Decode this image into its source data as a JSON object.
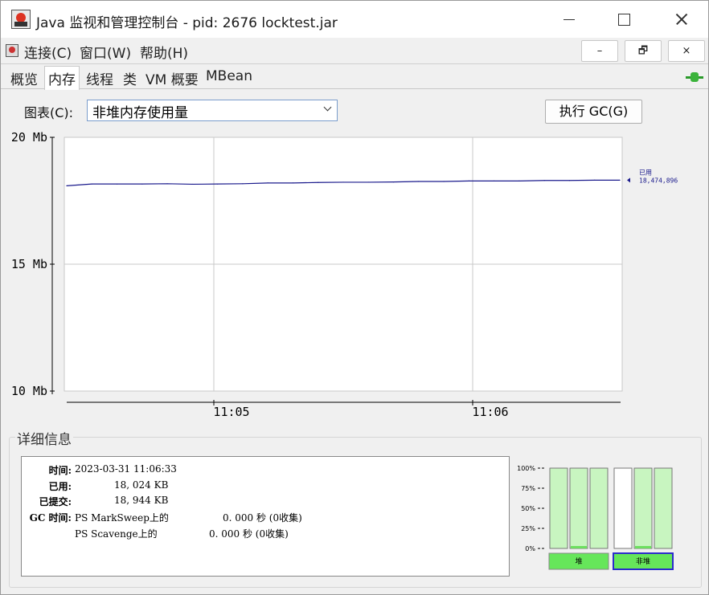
{
  "window": {
    "title": "Java 监视和管理控制台 - pid: 2676 locktest.jar"
  },
  "menu": {
    "items": [
      "连接(C)",
      "窗口(W)",
      "帮助(H)"
    ],
    "mdi_buttons": [
      "–",
      "🗗",
      "×"
    ]
  },
  "tabs": [
    {
      "label": "概览",
      "active": false
    },
    {
      "label": "内存",
      "active": true
    },
    {
      "label": "线程",
      "active": false
    },
    {
      "label": "类",
      "active": false
    },
    {
      "label": "VM 概要",
      "active": false
    },
    {
      "label": "MBean",
      "active": false
    }
  ],
  "chart_selector": {
    "label": "图表(C):",
    "value": "非堆内存使用量"
  },
  "gc_button": {
    "label": "执行 GC(G)"
  },
  "chart_data": {
    "type": "line",
    "y_ticks": [
      "20 Mb",
      "15 Mb",
      "10 Mb"
    ],
    "x_ticks": [
      "11:05",
      "11:06"
    ],
    "ylim_mb": [
      10,
      20
    ],
    "grid": true,
    "series": [
      {
        "name": "已用",
        "color": "#1a1a8c",
        "current_label": "18,474,896",
        "values_mb": [
          18.09,
          18.16,
          18.16,
          18.16,
          18.17,
          18.15,
          18.16,
          18.17,
          18.2,
          18.2,
          18.22,
          18.23,
          18.23,
          18.24,
          18.26,
          18.26,
          18.28,
          18.28,
          18.28,
          18.3,
          18.3,
          18.31,
          18.31
        ]
      }
    ]
  },
  "details": {
    "title": "详细信息",
    "time_label": "时间:",
    "time_value": "2023-03-31 11:06:33",
    "used_label": "已用:",
    "used_value": "18, 024 KB",
    "committed_label": "已提交:",
    "committed_value": "18, 944 KB",
    "gc_label": "GC 时间:",
    "gc_rows": [
      {
        "name": "PS MarkSweep上的",
        "value": "0. 000 秒 (0收集)"
      },
      {
        "name": "PS Scavenge上的",
        "value": "0. 000 秒 (0收集)"
      }
    ]
  },
  "pool_bars": {
    "y_ticks": [
      "100%",
      "75%",
      "50%",
      "25%",
      "0%"
    ],
    "heap": {
      "label": "堆",
      "fractions": [
        0,
        0.03,
        0
      ]
    },
    "nonheap": {
      "label": "非堆",
      "fractions": [
        0,
        0.03,
        0
      ],
      "selected": true
    },
    "colors": {
      "bar_fill": "#c8f5c0",
      "bar_used": "#6ddf5f",
      "button": "#66e65a",
      "selected_border": "#2b2bcc"
    }
  }
}
